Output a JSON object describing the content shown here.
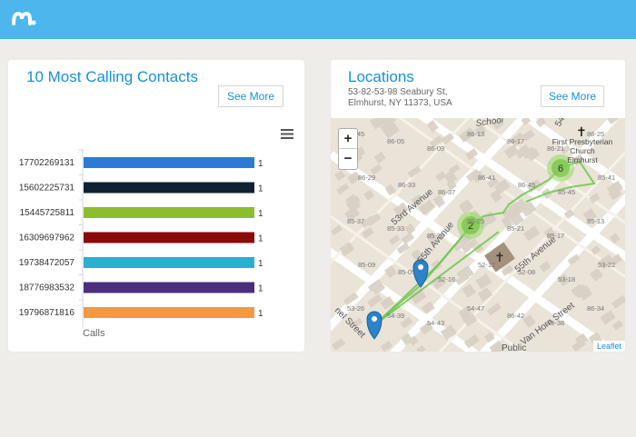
{
  "header": {
    "logo_icon": "mspy-logo",
    "brand_color": "#4db6ec"
  },
  "contacts_card": {
    "title": "10 Most Calling Contacts",
    "see_more_label": "See More",
    "menu_icon": "hamburger-menu-icon"
  },
  "chart_data": {
    "type": "bar",
    "orientation": "horizontal",
    "categories": [
      "17702269131",
      "15602225731",
      "15445725811",
      "16309697962",
      "19738472057",
      "18776983532",
      "19796871816"
    ],
    "values": [
      1,
      1,
      1,
      1,
      1,
      1,
      1
    ],
    "colors": [
      "#2d7ad6",
      "#0f2233",
      "#8cbd2d",
      "#8b0a0a",
      "#2ab0cc",
      "#4b2d7d",
      "#f39a3c"
    ],
    "data_labels": [
      "1",
      "1",
      "1",
      "1",
      "1",
      "1",
      "1"
    ],
    "xlabel": "Calls",
    "ylabel": ""
  },
  "locations_card": {
    "title": "Locations",
    "address_line1": "53-82-53-98 Seabury St,",
    "address_line2": "Elmhurst, NY 11373, USA",
    "see_more_label": "See More",
    "map": {
      "zoom_in": "+",
      "zoom_out": "−",
      "attribution": "Leaflet",
      "street_labels": [
        "53rd Avenue",
        "55th Avenue",
        "55th Avenue",
        "Van Horn Street",
        "School",
        "54th",
        "Public",
        "nel Street"
      ],
      "place_label_1": "First Presbyterian",
      "place_label_2": "Church",
      "place_label_3": "Elmhurst",
      "cluster_labels": [
        "6",
        "2"
      ],
      "house_numbers": [
        "86-45",
        "86-05",
        "86-09",
        "86-13",
        "86-17",
        "86-21",
        "86-25",
        "86-29",
        "86-33",
        "86-37",
        "86-41",
        "86-45",
        "85-45",
        "85-41",
        "85-37",
        "85-33",
        "85-29",
        "85-25",
        "85-21",
        "85-17",
        "85-13",
        "85-09",
        "85-05",
        "52-16",
        "52-12",
        "52-08",
        "53-18",
        "53-22",
        "53-26",
        "54-39",
        "54-43",
        "54-47",
        "86-42",
        "86-38",
        "86-34"
      ]
    }
  }
}
